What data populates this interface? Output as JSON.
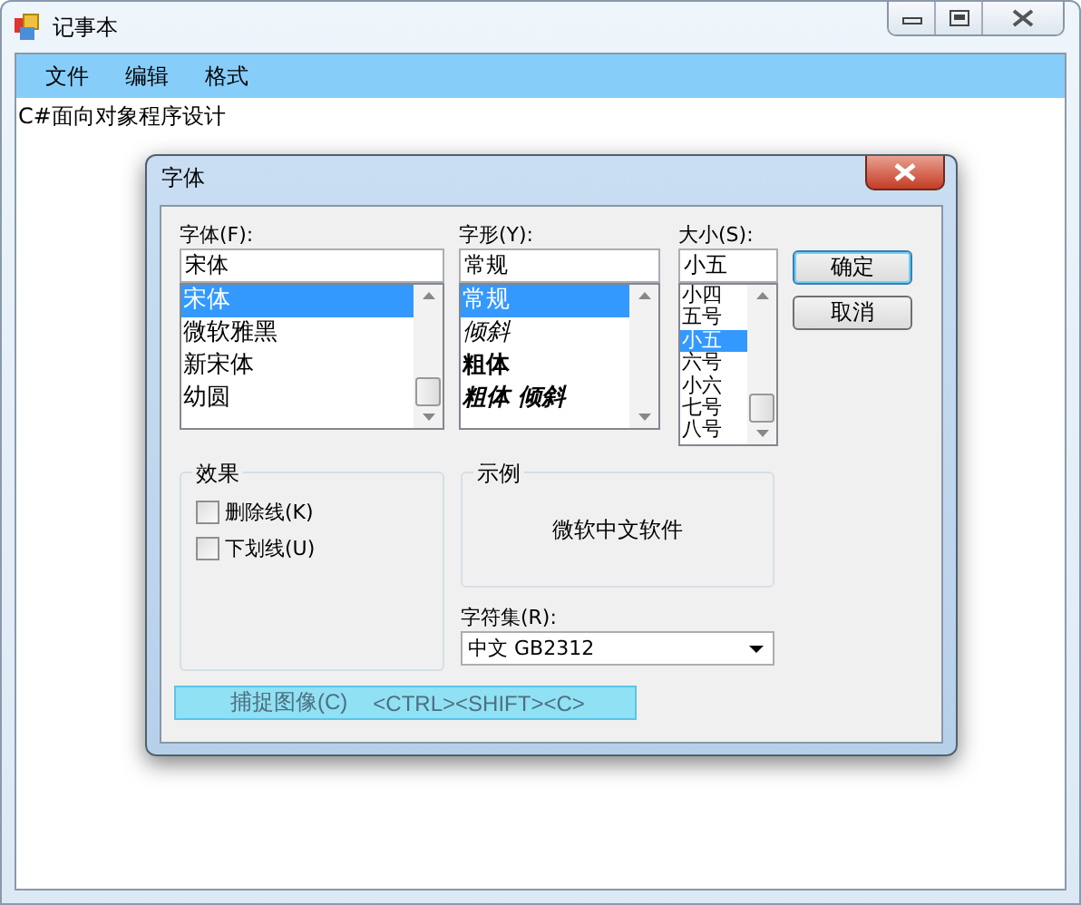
{
  "window": {
    "title": "记事本"
  },
  "menu": [
    {
      "label": "文件"
    },
    {
      "label": "编辑"
    },
    {
      "label": "格式"
    }
  ],
  "document": {
    "text": "C#面向对象程序设计"
  },
  "dialog": {
    "title": "字体",
    "font": {
      "label": "字体(F):",
      "value": "宋体",
      "options": [
        {
          "label": "宋体",
          "selected": true
        },
        {
          "label": "微软雅黑",
          "selected": false
        },
        {
          "label": "新宋体",
          "selected": false
        },
        {
          "label": "幼圆",
          "selected": false
        }
      ]
    },
    "style": {
      "label": "字形(Y):",
      "value": "常规",
      "options": [
        {
          "label": "常规",
          "kind": "regular",
          "selected": true
        },
        {
          "label": "倾斜",
          "kind": "italic",
          "selected": false
        },
        {
          "label": "粗体",
          "kind": "bold",
          "selected": false
        },
        {
          "label": "粗体 倾斜",
          "kind": "bold-italic",
          "selected": false
        }
      ]
    },
    "size": {
      "label": "大小(S):",
      "value": "小五",
      "options": [
        {
          "label": "小四",
          "selected": false
        },
        {
          "label": "五号",
          "selected": false
        },
        {
          "label": "小五",
          "selected": true
        },
        {
          "label": "六号",
          "selected": false
        },
        {
          "label": "小六",
          "selected": false
        },
        {
          "label": "七号",
          "selected": false
        },
        {
          "label": "八号",
          "selected": false
        }
      ]
    },
    "buttons": [
      {
        "label": "确定",
        "kind": "default"
      },
      {
        "label": "取消",
        "kind": "normal"
      }
    ],
    "effects": {
      "title": "效果",
      "options": [
        {
          "label": "删除线(K)",
          "checked": false
        },
        {
          "label": "下划线(U)",
          "checked": false
        }
      ]
    },
    "sample": {
      "title": "示例",
      "text": "微软中文软件"
    },
    "charset": {
      "label": "字符集(R):",
      "value": "中文 GB2312"
    }
  },
  "tooltip": {
    "label": "捕捉图像(C)",
    "shortcut": "<CTRL><SHIFT><C>"
  }
}
